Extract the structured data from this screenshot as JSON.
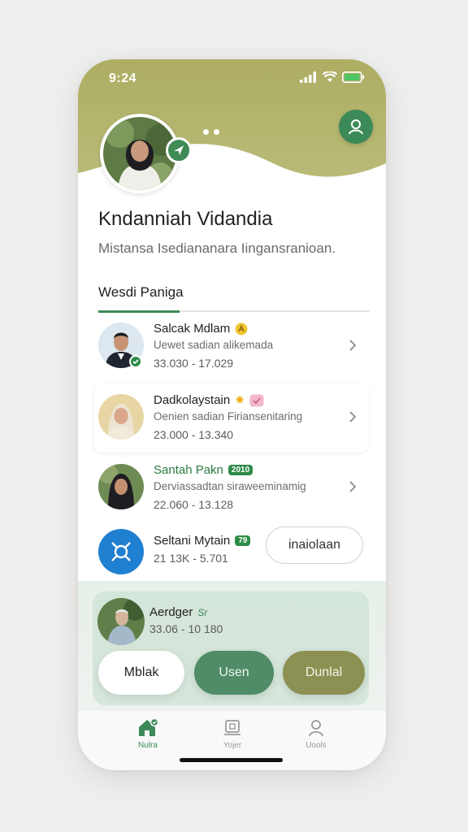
{
  "status": {
    "time": "9:24"
  },
  "profile": {
    "name": "Kndanniah Vidandia",
    "bio": "Mistansa Isediananara Iingansranioan."
  },
  "section": {
    "title": "Wesdi Paniga"
  },
  "list": [
    {
      "name": "Salcak Mdlam",
      "sub": "Uewet sadian alikemada",
      "meta": "33.030  -  17.029"
    },
    {
      "name": "Dadkolaystain",
      "sub": "Oenien sadian Firiansenitaring",
      "meta": "23.000  -  13.340"
    },
    {
      "name": "Santah Pakn",
      "tag": "2010",
      "sub": "Derviassadtan siraweeminamig",
      "meta": "22.060  -  13.128"
    },
    {
      "name": "Seltani Mytain",
      "tag": "79",
      "meta": "21 13K  -  5.701",
      "button": "inaiolaan"
    }
  ],
  "card": {
    "name": "Aerdger",
    "suffix": "Sr",
    "meta": "33.06  -  10 180"
  },
  "actions": {
    "left": "Mblak",
    "middle": "Usen",
    "right": "Dunlal"
  },
  "tabs": [
    {
      "label": "Nulra",
      "icon": "home-icon",
      "active": true
    },
    {
      "label": "Yojer",
      "icon": "device-icon",
      "active": false
    },
    {
      "label": "Uools",
      "icon": "user-icon",
      "active": false
    }
  ],
  "colors": {
    "accent": "#3c8a57",
    "header": "#b3b46c",
    "olive": "#8c9153"
  }
}
